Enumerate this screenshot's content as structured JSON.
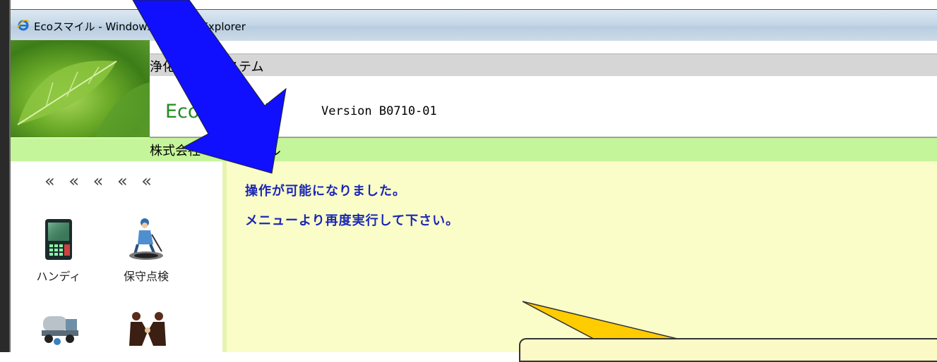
{
  "window": {
    "title": "Ecoスマイル - Windows Internet Explorer"
  },
  "header": {
    "system_label": "浄化槽管理システム",
    "app_name": "Ecoスマイル",
    "version": "Version B0710-01",
    "company": "株式会社 シーエーエル"
  },
  "menu": {
    "collapse_chevrons": "« « « « «",
    "items": [
      {
        "label": "ハンディ",
        "icon": "handheld-terminal-icon"
      },
      {
        "label": "保守点検",
        "icon": "maintenance-worker-icon"
      },
      {
        "label": "",
        "icon": "vacuum-truck-icon"
      },
      {
        "label": "",
        "icon": "handshake-icon"
      }
    ]
  },
  "content": {
    "messages": [
      "操作が可能になりました。",
      "メニューより再度実行して下さい。"
    ]
  },
  "colors": {
    "arrow_blue": "#1010ff",
    "callout_yellow": "#ffcc00",
    "message_text": "#1a26b5",
    "eco_green": "#228b22",
    "green_bar": "#c5f59a",
    "content_bg": "#fafdc8"
  }
}
